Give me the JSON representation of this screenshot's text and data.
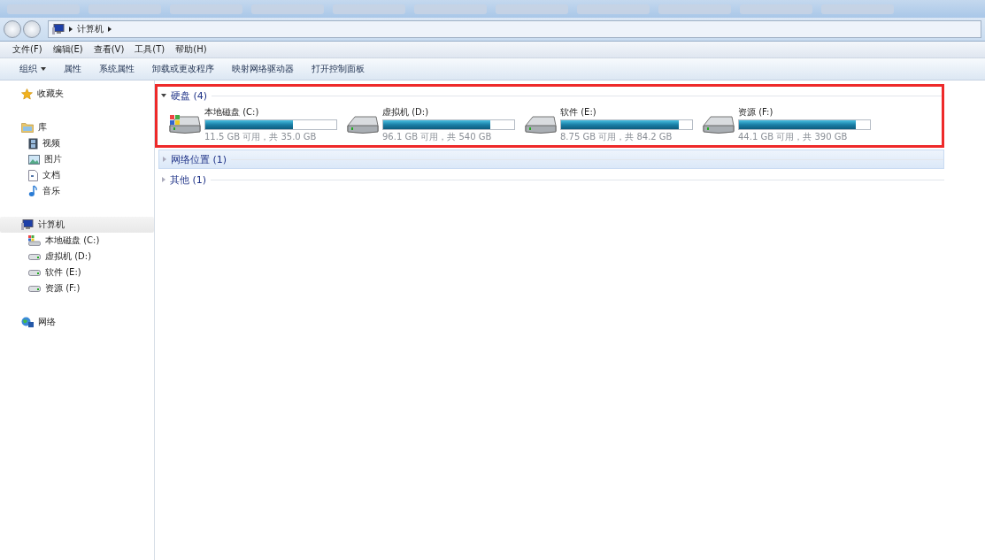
{
  "address_bar": {
    "crumbs": [
      "计算机"
    ]
  },
  "menu_bar": [
    "文件(F)",
    "编辑(E)",
    "查看(V)",
    "工具(T)",
    "帮助(H)"
  ],
  "toolbar": [
    {
      "label": "组织",
      "kind": "dropdown"
    },
    {
      "label": "属性",
      "kind": "plain"
    },
    {
      "label": "系统属性",
      "kind": "plain"
    },
    {
      "label": "卸载或更改程序",
      "kind": "plain"
    },
    {
      "label": "映射网络驱动器",
      "kind": "plain"
    },
    {
      "label": "打开控制面板",
      "kind": "plain"
    }
  ],
  "sidebar": {
    "groups": [
      {
        "label": "收藏夹",
        "kind": "star",
        "selected": false
      },
      {
        "label": "库",
        "kind": "library",
        "selected": false,
        "children": [
          {
            "label": "视频",
            "kind": "video"
          },
          {
            "label": "图片",
            "kind": "image"
          },
          {
            "label": "文档",
            "kind": "document"
          },
          {
            "label": "音乐",
            "kind": "music"
          }
        ]
      },
      {
        "label": "计算机",
        "kind": "computer",
        "selected": true,
        "children": [
          {
            "label": "本地磁盘 (C:)",
            "kind": "system-drive"
          },
          {
            "label": "虚拟机 (D:)",
            "kind": "drive"
          },
          {
            "label": "软件 (E:)",
            "kind": "drive"
          },
          {
            "label": "资源 (F:)",
            "kind": "drive"
          }
        ]
      },
      {
        "label": "网络",
        "kind": "network",
        "selected": false
      }
    ]
  },
  "content": {
    "groups": [
      {
        "title": "硬盘 (4)",
        "expanded": true,
        "selected": false,
        "annotated": true,
        "drives": [
          {
            "name": "本地磁盘 (C:)",
            "kind": "system-drive",
            "level": 0.67,
            "reading": "11.5 GB 可用，共 35.0 GB"
          },
          {
            "name": "虚拟机 (D:)",
            "kind": "drive",
            "level": 0.82,
            "reading": "96.1 GB 可用，共 540 GB"
          },
          {
            "name": "软件 (E:)",
            "kind": "drive",
            "level": 0.9,
            "reading": "8.75 GB 可用，共 84.2 GB"
          },
          {
            "name": "资源 (F:)",
            "kind": "drive",
            "level": 0.89,
            "reading": "44.1 GB 可用，共 390 GB"
          }
        ]
      },
      {
        "title": "网络位置 (1)",
        "expanded": false,
        "selected": true,
        "annotated": false
      },
      {
        "title": "其他 (1)",
        "expanded": false,
        "selected": false,
        "annotated": false
      }
    ]
  }
}
